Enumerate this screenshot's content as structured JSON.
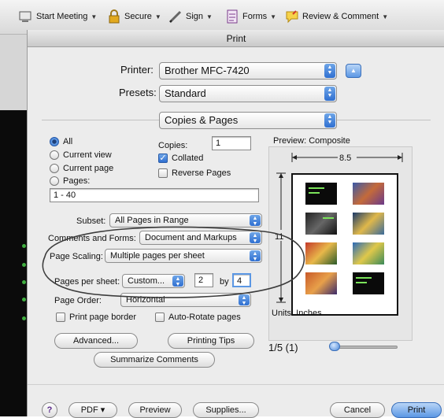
{
  "toolbar": {
    "start_meeting": "Start Meeting",
    "secure": "Secure",
    "sign": "Sign",
    "forms": "Forms",
    "review": "Review & Comment"
  },
  "dialog": {
    "title": "Print",
    "printer_label": "Printer:",
    "printer_value": "Brother MFC-7420",
    "presets_label": "Presets:",
    "presets_value": "Standard",
    "panel_value": "Copies & Pages",
    "range": {
      "all": "All",
      "current_view": "Current view",
      "current_page": "Current page",
      "pages": "Pages:",
      "pages_value": "1 - 40"
    },
    "copies_label": "Copies:",
    "copies_value": "1",
    "collated": "Collated",
    "reverse_pages": "Reverse Pages",
    "preview_label": "Preview: Composite",
    "width_label": "8.5",
    "height_label": "11",
    "units_label": "Units: Inches",
    "subset_label": "Subset:",
    "subset_value": "All Pages in Range",
    "comments_label": "Comments and Forms:",
    "comments_value": "Document and Markups",
    "scaling_label": "Page Scaling:",
    "scaling_value": "Multiple pages per sheet",
    "pps_label": "Pages per sheet:",
    "pps_value": "Custom...",
    "pps_cols": "2",
    "pps_by": "by",
    "pps_rows": "4",
    "order_label": "Page Order:",
    "order_value": "Horizontal",
    "print_border": "Print page border",
    "auto_rotate": "Auto-Rotate pages",
    "page_indicator": "1/5 (1)",
    "buttons": {
      "advanced": "Advanced...",
      "printing_tips": "Printing Tips",
      "summarize": "Summarize Comments",
      "help": "?",
      "pdf": "PDF ▾",
      "preview": "Preview",
      "supplies": "Supplies...",
      "cancel": "Cancel",
      "print": "Print"
    }
  },
  "colors": {
    "accent": "#2f6fd1",
    "dialog_bg": "#ececec"
  }
}
